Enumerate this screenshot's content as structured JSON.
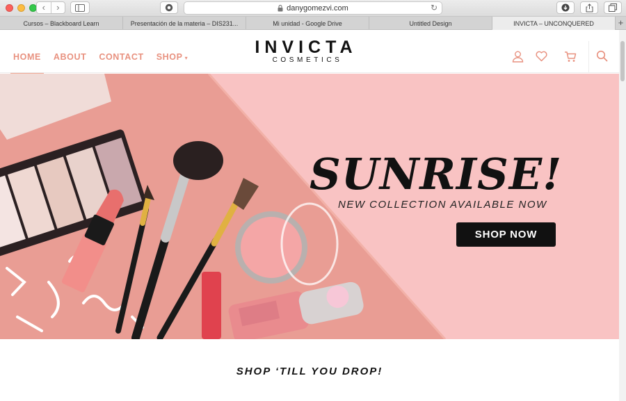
{
  "browser": {
    "url": "danygomezvi.com",
    "tabs": [
      {
        "label": "Cursos – Blackboard Learn"
      },
      {
        "label": "Presentación de la materia – DIS231..."
      },
      {
        "label": "Mi unidad - Google Drive"
      },
      {
        "label": "Untitled Design"
      },
      {
        "label": "INVICTA – UNCONQUERED"
      }
    ],
    "new_tab_label": "+",
    "colors": {
      "close": "#fc605b",
      "minimize": "#fdbc40",
      "zoom": "#34c84a"
    }
  },
  "header": {
    "nav": [
      {
        "label": "HOME"
      },
      {
        "label": "ABOUT"
      },
      {
        "label": "CONTACT"
      },
      {
        "label": "SHOP"
      }
    ],
    "shop_caret": "▾",
    "logo_main": "INVICTA",
    "logo_sub": "COSMETICS",
    "icons": [
      "user-icon",
      "heart-icon",
      "cart-icon",
      "search-icon"
    ],
    "accent_color": "#e8917f"
  },
  "hero": {
    "title": "SUNRISE!",
    "subtitle": "NEW COLLECTION AVAILABLE NOW",
    "button": "SHOP NOW",
    "background_color": "#f9c3c3"
  },
  "section": {
    "title": "SHOP ‘TILL YOU DROP!"
  }
}
